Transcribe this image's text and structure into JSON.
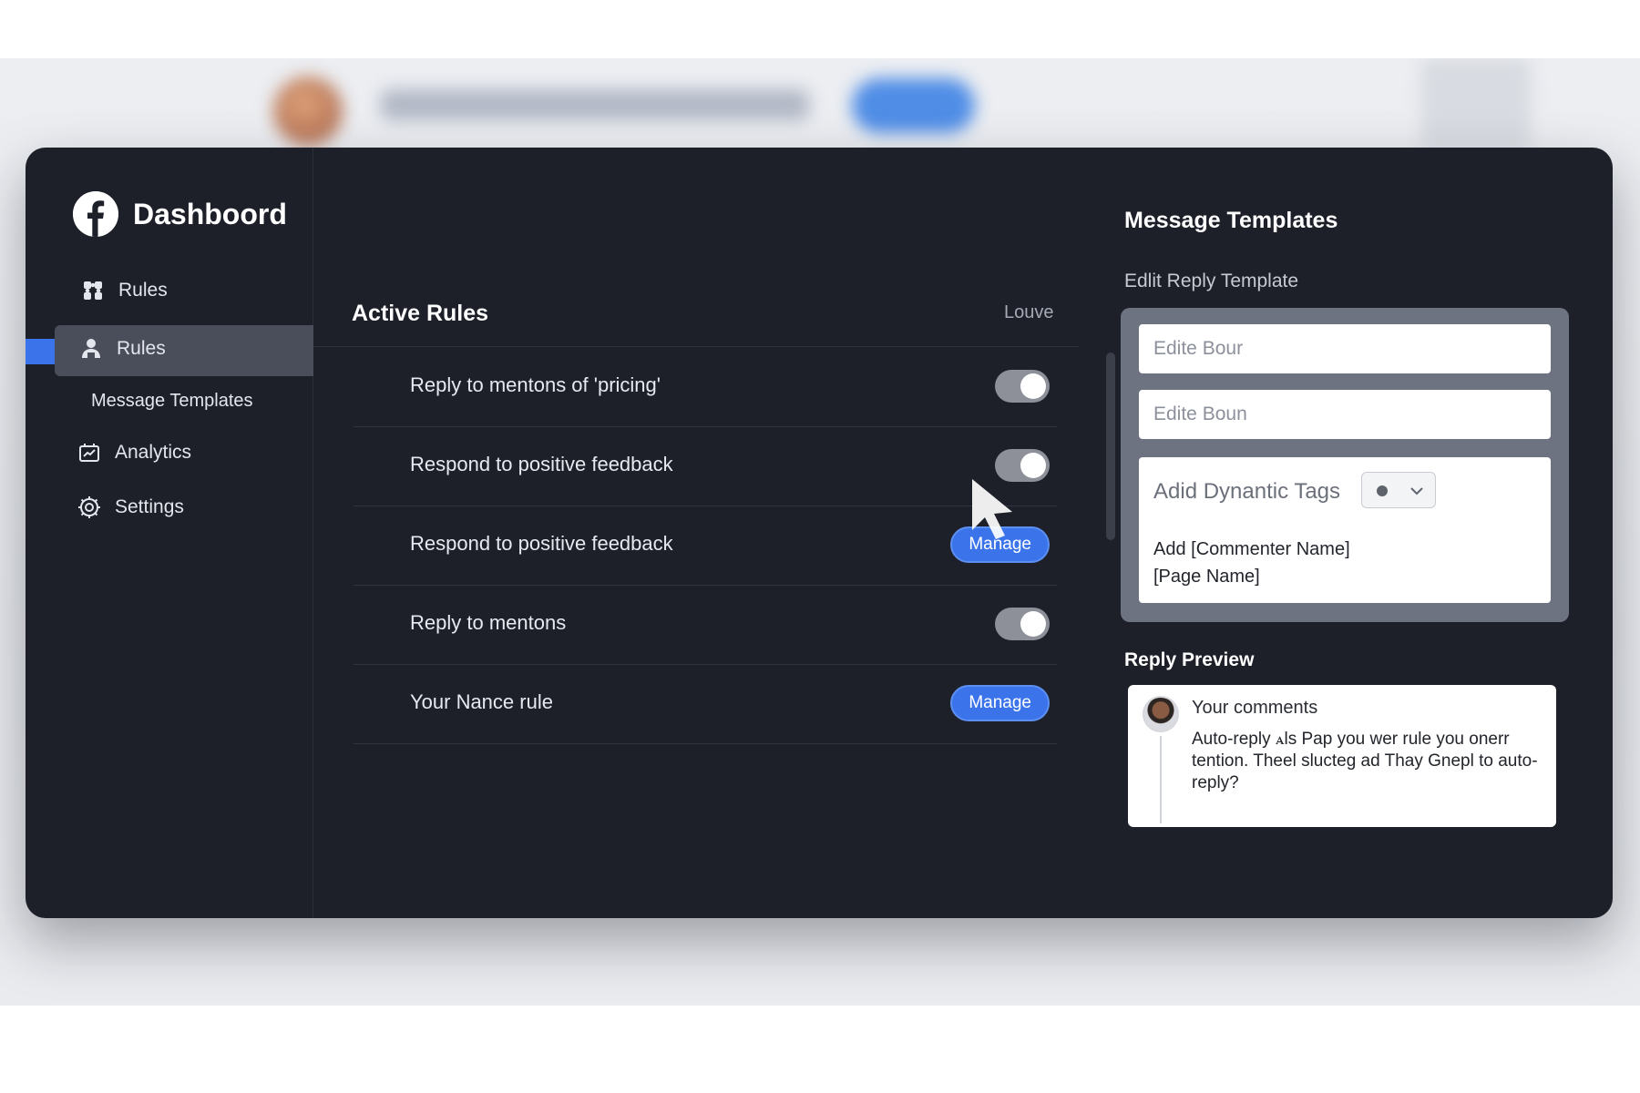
{
  "sidebar": {
    "brand_title": "Dashboord",
    "items": [
      {
        "label": "Rules",
        "icon": "puzzle-icon"
      },
      {
        "label": "Rules",
        "icon": "people-icon",
        "active": true
      },
      {
        "label": "Message Templates"
      },
      {
        "label": "Analytics",
        "icon": "chart-icon"
      },
      {
        "label": "Settings",
        "icon": "gear-icon"
      }
    ]
  },
  "rules": {
    "title": "Active Rules",
    "header_right": "Louve",
    "rows": [
      {
        "label": "Reply to mentons of 'pricing'",
        "control": "toggle",
        "on": true
      },
      {
        "label": "Respond to positive feedback",
        "control": "toggle",
        "on": true
      },
      {
        "label": "Respond to positive feedback",
        "control": "button",
        "button_label": "Manage"
      },
      {
        "label": "Reply to mentons",
        "control": "toggle",
        "on": true
      },
      {
        "label": "Your Nance rule",
        "control": "button",
        "button_label": "Manage"
      }
    ]
  },
  "templates": {
    "title": "Message Templates",
    "subtitle": "Edlit Reply Template",
    "input1_value": "Edite Bour",
    "input2_value": "Edite Boun",
    "tags_label": "Adid Dynantic Tags",
    "tags_text_line1": "Add [Commenter Name]",
    "tags_text_line2": "[Page Name]"
  },
  "preview": {
    "title": "Reply Preview",
    "commenter": "Your comments",
    "text": "Auto-reply ꭺls Pap you wer rule you onerr tention. Theel slucteg ad Thay Gnepl to auto-reply?"
  },
  "colors": {
    "window_bg": "#1d2029",
    "accent": "#3b74ea",
    "toggle_track": "#8d9099"
  }
}
